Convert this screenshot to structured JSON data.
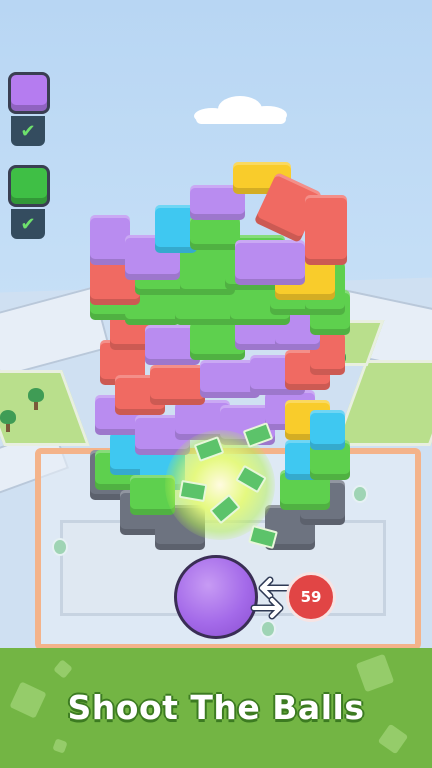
{
  "level_progress": [
    {
      "color": "#b57cf0",
      "status": "complete",
      "check_icon": "✔"
    },
    {
      "color": "#3fbf45",
      "status": "complete",
      "check_icon": "✔"
    }
  ],
  "shooter": {
    "ball_color": "#a46ae9",
    "remaining_balls": "59",
    "badge_color": "#e14545"
  },
  "caption": {
    "text": "Shoot The Balls",
    "background_color": "#73b544"
  },
  "icons": [
    "cloud-icon",
    "check-icon",
    "swap-arrows-icon",
    "tree-icon"
  ]
}
